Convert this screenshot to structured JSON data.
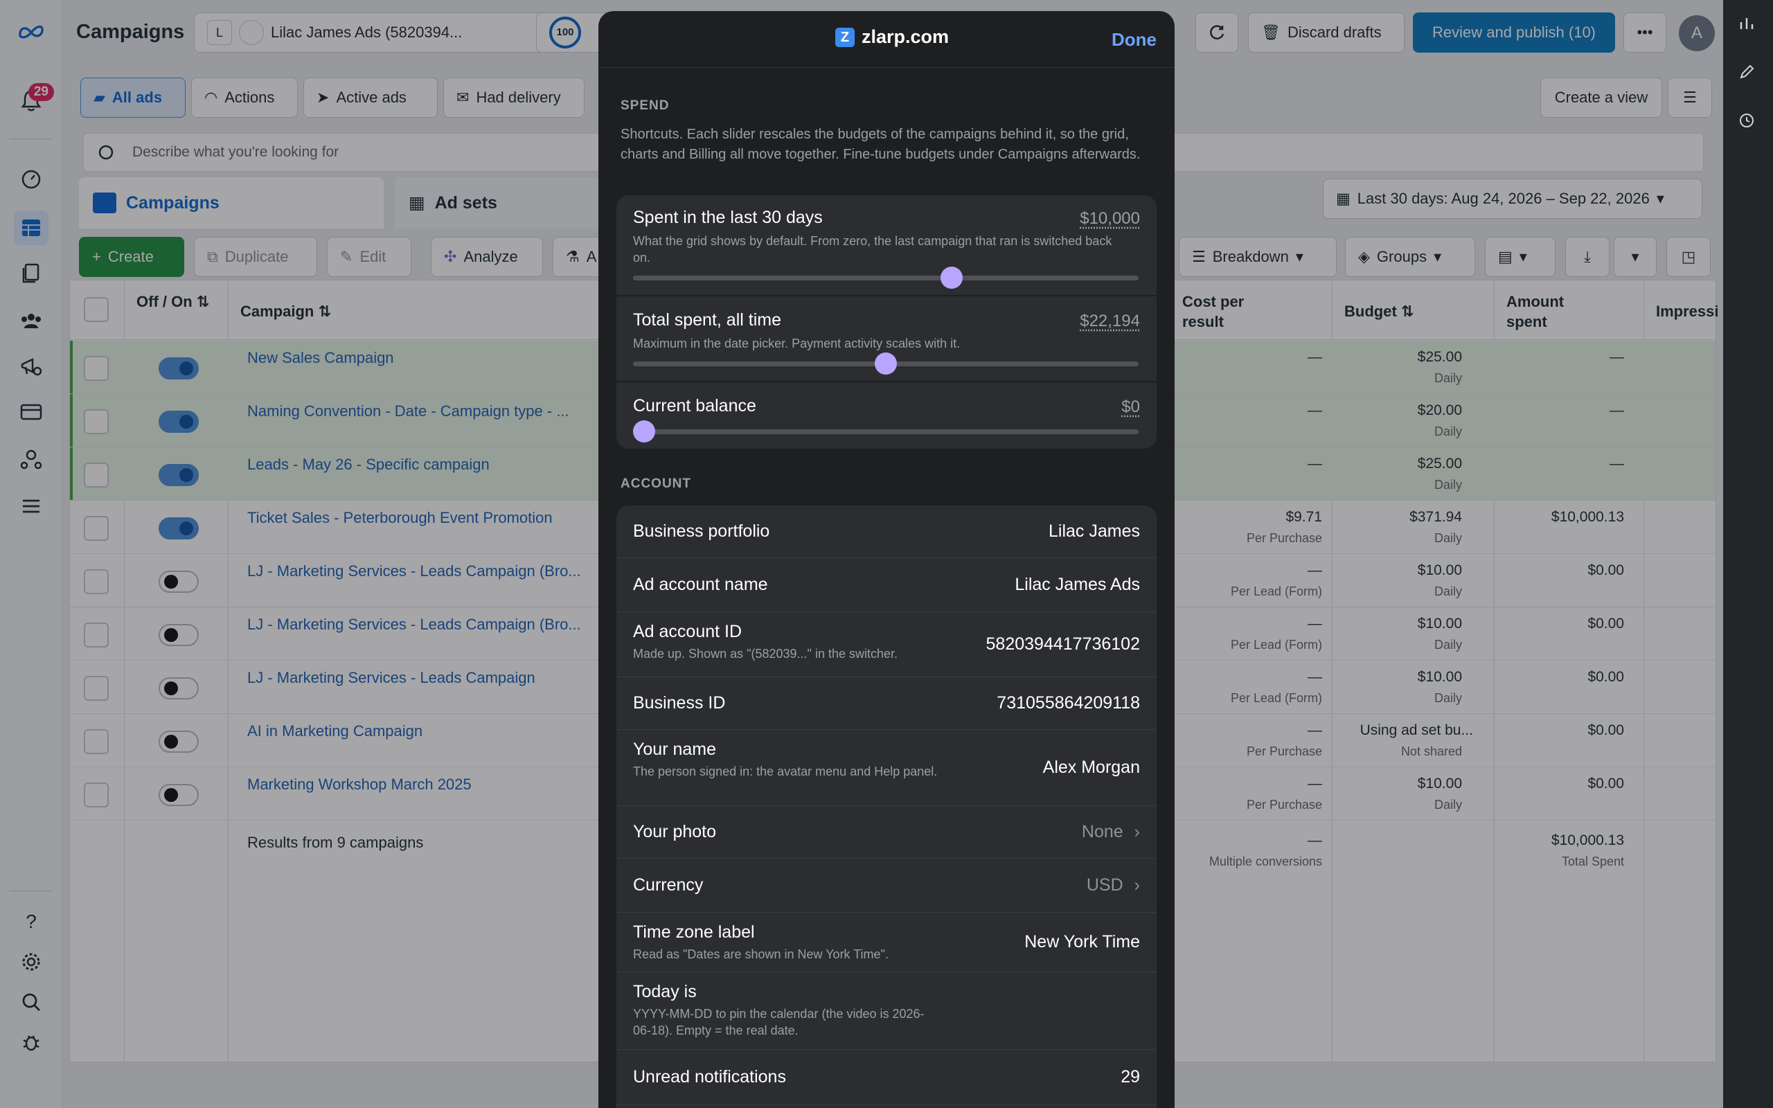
{
  "app": {
    "title": "Campaigns",
    "account_initial": "L",
    "account_name": "Lilac James Ads (5820394...",
    "score": "100",
    "notifications_count": "29",
    "avatar_initial": "A"
  },
  "toolbar": {
    "discard": "Discard drafts",
    "review": "Review and publish (10)",
    "create_view": "Create a view",
    "all_ads": "All ads",
    "actions": "Actions",
    "active_ads": "Active ads",
    "had_delivery": "Had delivery",
    "search_placeholder": "Describe what you're looking for",
    "date_range": "Last 30 days: Aug 24, 2026 – Sep 22, 2026"
  },
  "tabs": {
    "campaigns": "Campaigns",
    "ad_sets": "Ad sets"
  },
  "actions": {
    "create": "Create",
    "duplicate": "Duplicate",
    "edit": "Edit",
    "analyze": "Analyze",
    "a": "A",
    "breakdown": "Breakdown",
    "groups": "Groups"
  },
  "columns": {
    "offon": "Off / On",
    "campaign": "Campaign",
    "cpr1": "Cost per",
    "cpr2": "result",
    "budget": "Budget",
    "amount1": "Amount",
    "amount2": "spent",
    "impressions": "Impressi"
  },
  "rows": [
    {
      "name": "New Sales Campaign",
      "on": true,
      "cost": "—",
      "cost_sub": "",
      "budget": "$25.00",
      "budget_sub": "Daily",
      "spent": "—",
      "hl": true
    },
    {
      "name": "Naming Convention - Date - Campaign type - ...",
      "on": true,
      "cost": "—",
      "cost_sub": "",
      "budget": "$20.00",
      "budget_sub": "Daily",
      "spent": "—",
      "hl": true
    },
    {
      "name": "Leads - May 26 - Specific campaign",
      "on": true,
      "cost": "—",
      "cost_sub": "",
      "budget": "$25.00",
      "budget_sub": "Daily",
      "spent": "—",
      "hl": true
    },
    {
      "name": "Ticket Sales - Peterborough Event Promotion",
      "on": true,
      "cost": "$9.71",
      "cost_sub": "Per Purchase",
      "budget": "$371.94",
      "budget_sub": "Daily",
      "spent": "$10,000.13",
      "hl": false
    },
    {
      "name": "LJ - Marketing Services - Leads Campaign (Bro...",
      "on": false,
      "cost": "—",
      "cost_sub": "Per Lead (Form)",
      "budget": "$10.00",
      "budget_sub": "Daily",
      "spent": "$0.00",
      "hl": false
    },
    {
      "name": "LJ - Marketing Services - Leads Campaign (Bro...",
      "on": false,
      "cost": "—",
      "cost_sub": "Per Lead (Form)",
      "budget": "$10.00",
      "budget_sub": "Daily",
      "spent": "$0.00",
      "hl": false
    },
    {
      "name": "LJ - Marketing Services - Leads Campaign",
      "on": false,
      "cost": "—",
      "cost_sub": "Per Lead (Form)",
      "budget": "$10.00",
      "budget_sub": "Daily",
      "spent": "$0.00",
      "hl": false
    },
    {
      "name": "AI in Marketing Campaign",
      "on": false,
      "cost": "—",
      "cost_sub": "Per Purchase",
      "budget": "Using ad set bu...",
      "budget_sub": "Not shared",
      "spent": "$0.00",
      "hl": false
    },
    {
      "name": "Marketing Workshop March 2025",
      "on": false,
      "cost": "—",
      "cost_sub": "Per Purchase",
      "budget": "$10.00",
      "budget_sub": "Daily",
      "spent": "$0.00",
      "hl": false
    }
  ],
  "totals": {
    "label": "Results from 9 campaigns",
    "cost": "—",
    "cost_sub": "Multiple conversions",
    "spent": "$10,000.13",
    "spent_sub": "Total Spent"
  },
  "modal": {
    "site": "zlarp.com",
    "done": "Done",
    "spend_title": "SPEND",
    "spend_desc": "Shortcuts. Each slider rescales the budgets of the campaigns behind it, so the grid, charts and Billing all move together. Fine-tune budgets under Campaigns afterwards.",
    "sliders": [
      {
        "label": "Spent in the last 30 days",
        "value": "$10,000",
        "desc": "What the grid shows by default. From zero, the last campaign that ran is switched back on.",
        "level": 0.63
      },
      {
        "label": "Total spent, all time",
        "value": "$22,194",
        "desc": "Maximum in the date picker. Payment activity scales with it.",
        "level": 0.5
      },
      {
        "label": "Current balance",
        "value": "$0",
        "desc": "",
        "level": 0
      }
    ],
    "account_title": "ACCOUNT",
    "account": [
      {
        "label": "Business portfolio",
        "value": "Lilac James",
        "desc": "",
        "muted": false,
        "chev": false
      },
      {
        "label": "Ad account name",
        "value": "Lilac James Ads",
        "desc": "",
        "muted": false,
        "chev": false
      },
      {
        "label": "Ad account ID",
        "value": "5820394417736102",
        "desc": "Made up. Shown as \"(582039...\" in the switcher.",
        "muted": false,
        "chev": false
      },
      {
        "label": "Business ID",
        "value": "731055864209118",
        "desc": "",
        "muted": false,
        "chev": false
      },
      {
        "label": "Your name",
        "value": "Alex Morgan",
        "desc": "The person signed in: the avatar menu and Help panel.",
        "muted": false,
        "chev": false
      },
      {
        "label": "Your photo",
        "value": "None",
        "desc": "",
        "muted": true,
        "chev": true
      },
      {
        "label": "Currency",
        "value": "USD",
        "desc": "",
        "muted": true,
        "chev": true
      },
      {
        "label": "Time zone label",
        "value": "New York Time",
        "desc": "Read as \"Dates are shown in New York Time\".",
        "muted": false,
        "chev": false
      },
      {
        "label": "Today is",
        "value": "",
        "desc": "YYYY-MM-DD to pin the calendar (the video is 2026-06-18). Empty = the real date.",
        "muted": false,
        "chev": false
      },
      {
        "label": "Unread notifications",
        "value": "29",
        "desc": "",
        "muted": false,
        "chev": false
      }
    ]
  },
  "colors": {
    "accent": "#0a78be",
    "slider_thumb": "#b7a5ff",
    "modal_bg": "#1e1f21"
  }
}
